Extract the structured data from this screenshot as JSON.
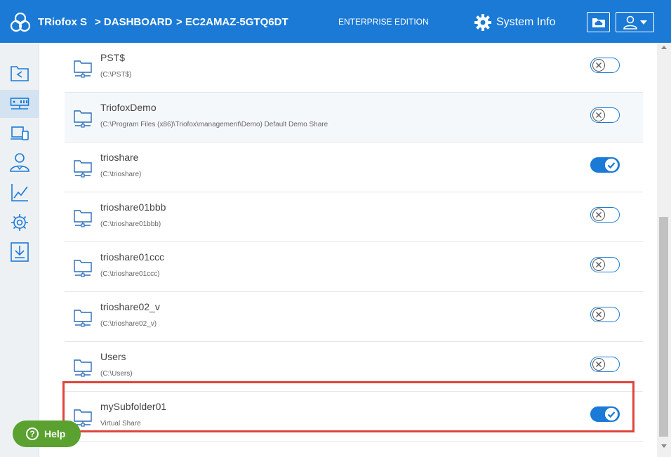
{
  "header": {
    "brand": "TRiofox S",
    "crumb1": "> DASHBOARD",
    "crumb2": "> EC2AMAZ-5GTQ6DT",
    "edition": "ENTERPRISE EDITION",
    "system_info": "System Info"
  },
  "colors": {
    "accent": "#1a7ad6",
    "highlight": "#e0443a",
    "help": "#5aa12f"
  },
  "sidebar": {
    "items": [
      {
        "icon": "folder-share-icon"
      },
      {
        "icon": "server-icon"
      },
      {
        "icon": "devices-icon"
      },
      {
        "icon": "users-icon"
      },
      {
        "icon": "chart-icon"
      },
      {
        "icon": "gear-icon"
      },
      {
        "icon": "download-icon"
      }
    ]
  },
  "shares": [
    {
      "name": "PST$",
      "path": "(C:\\PST$)",
      "enabled": false
    },
    {
      "name": "TriofoxDemo",
      "path": "(C:\\Program Files (x86)\\Triofox\\management\\Demo) Default Demo Share",
      "enabled": false
    },
    {
      "name": "trioshare",
      "path": "(C:\\trioshare)",
      "enabled": true
    },
    {
      "name": "trioshare01bbb",
      "path": "(C:\\trioshare01bbb)",
      "enabled": false
    },
    {
      "name": "trioshare01ccc",
      "path": "(C:\\trioshare01ccc)",
      "enabled": false
    },
    {
      "name": "trioshare02_v",
      "path": "(C:\\trioshare02_v)",
      "enabled": false
    },
    {
      "name": "Users",
      "path": "(C:\\Users)",
      "enabled": false
    },
    {
      "name": "mySubfolder01",
      "path": "Virtual Share",
      "enabled": true
    }
  ],
  "help": {
    "label": "Help"
  }
}
